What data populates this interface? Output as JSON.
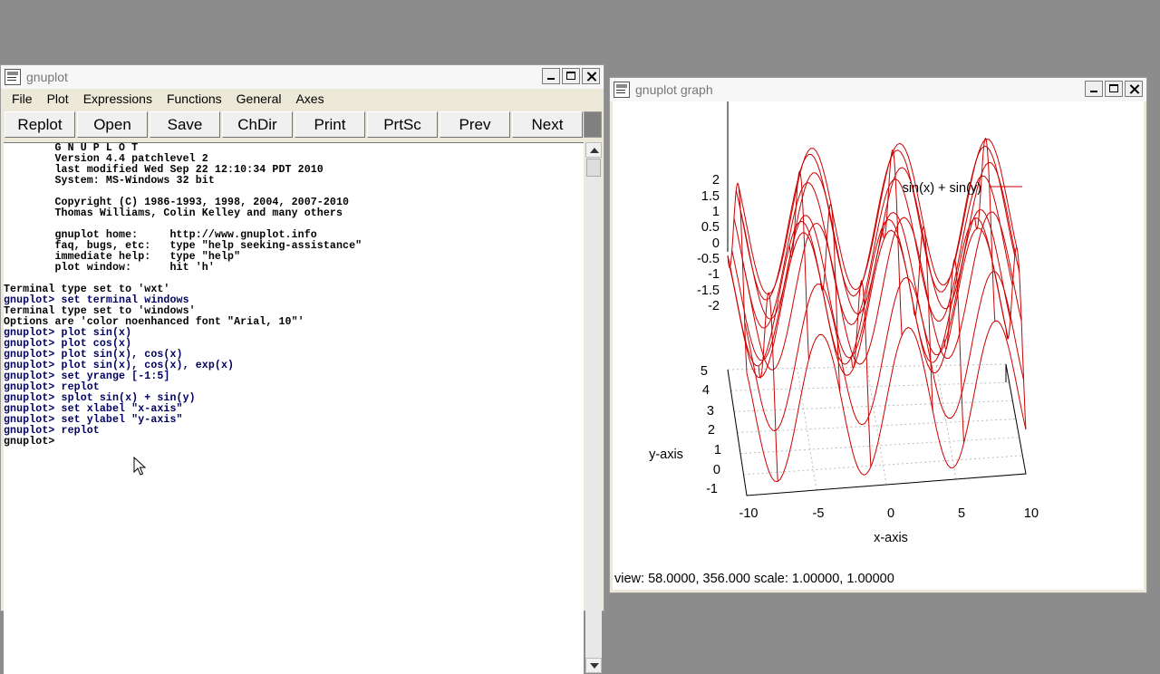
{
  "console_window": {
    "title": "gnuplot",
    "menu": [
      "File",
      "Plot",
      "Expressions",
      "Functions",
      "General",
      "Axes"
    ],
    "toolbar": [
      "Replot",
      "Open",
      "Save",
      "ChDir",
      "Print",
      "PrtSc",
      "Prev",
      "Next"
    ],
    "lines": [
      {
        "text": "        G N U P L O T",
        "style": "blk"
      },
      {
        "text": "        Version 4.4 patchlevel 2",
        "style": "blk"
      },
      {
        "text": "        last modified Wed Sep 22 12:10:34 PDT 2010",
        "style": "blk"
      },
      {
        "text": "        System: MS-Windows 32 bit",
        "style": "blk"
      },
      {
        "text": "",
        "style": "blk"
      },
      {
        "text": "        Copyright (C) 1986-1993, 1998, 2004, 2007-2010",
        "style": "blk"
      },
      {
        "text": "        Thomas Williams, Colin Kelley and many others",
        "style": "blk"
      },
      {
        "text": "",
        "style": "blk"
      },
      {
        "text": "        gnuplot home:     http://www.gnuplot.info",
        "style": "blk"
      },
      {
        "text": "        faq, bugs, etc:   type \"help seeking-assistance\"",
        "style": "blk"
      },
      {
        "text": "        immediate help:   type \"help\"",
        "style": "blk"
      },
      {
        "text": "        plot window:      hit 'h'",
        "style": "blk"
      },
      {
        "text": "",
        "style": "blk"
      },
      {
        "text": "Terminal type set to 'wxt'",
        "style": "blk"
      },
      {
        "text": "gnuplot> set terminal windows",
        "style": "blue"
      },
      {
        "text": "Terminal type set to 'windows'",
        "style": "blk"
      },
      {
        "text": "Options are 'color noenhanced font \"Arial, 10\"'",
        "style": "blk"
      },
      {
        "text": "gnuplot> plot sin(x)",
        "style": "blue"
      },
      {
        "text": "gnuplot> plot cos(x)",
        "style": "blue"
      },
      {
        "text": "gnuplot> plot sin(x), cos(x)",
        "style": "blue"
      },
      {
        "text": "gnuplot> plot sin(x), cos(x), exp(x)",
        "style": "blue"
      },
      {
        "text": "gnuplot> set yrange [-1:5]",
        "style": "blue"
      },
      {
        "text": "gnuplot> replot",
        "style": "blue"
      },
      {
        "text": "gnuplot> splot sin(x) + sin(y)",
        "style": "blue"
      },
      {
        "text": "gnuplot> set xlabel \"x-axis\"",
        "style": "blue"
      },
      {
        "text": "gnuplot> set ylabel \"y-axis\"",
        "style": "blue"
      },
      {
        "text": "gnuplot> replot",
        "style": "blue"
      },
      {
        "text": "gnuplot> ",
        "style": "blk"
      }
    ]
  },
  "graph_window": {
    "title": "gnuplot graph",
    "status": "view: 58.0000, 356.000  scale: 1.00000, 1.00000"
  },
  "chart_data": {
    "type": "surface",
    "function": "sin(x) + sin(y)",
    "legend": "sin(x) + sin(y)",
    "legend_position": "top-right",
    "xlabel": "x-axis",
    "ylabel": "y-axis",
    "xlim": [
      -10,
      10
    ],
    "ylim": [
      -1,
      5
    ],
    "zlim": [
      -2,
      2
    ],
    "x_ticks": [
      "-10",
      "-5",
      "0",
      "5",
      "10"
    ],
    "y_ticks": [
      "-1",
      "0",
      "1",
      "2",
      "3",
      "4",
      "5"
    ],
    "z_ticks": [
      "2",
      "1.5",
      "1",
      "0.5",
      "0",
      "-0.5",
      "-1",
      "-1.5",
      "-2"
    ],
    "view": [
      58,
      356
    ],
    "color": "#cc0000"
  }
}
